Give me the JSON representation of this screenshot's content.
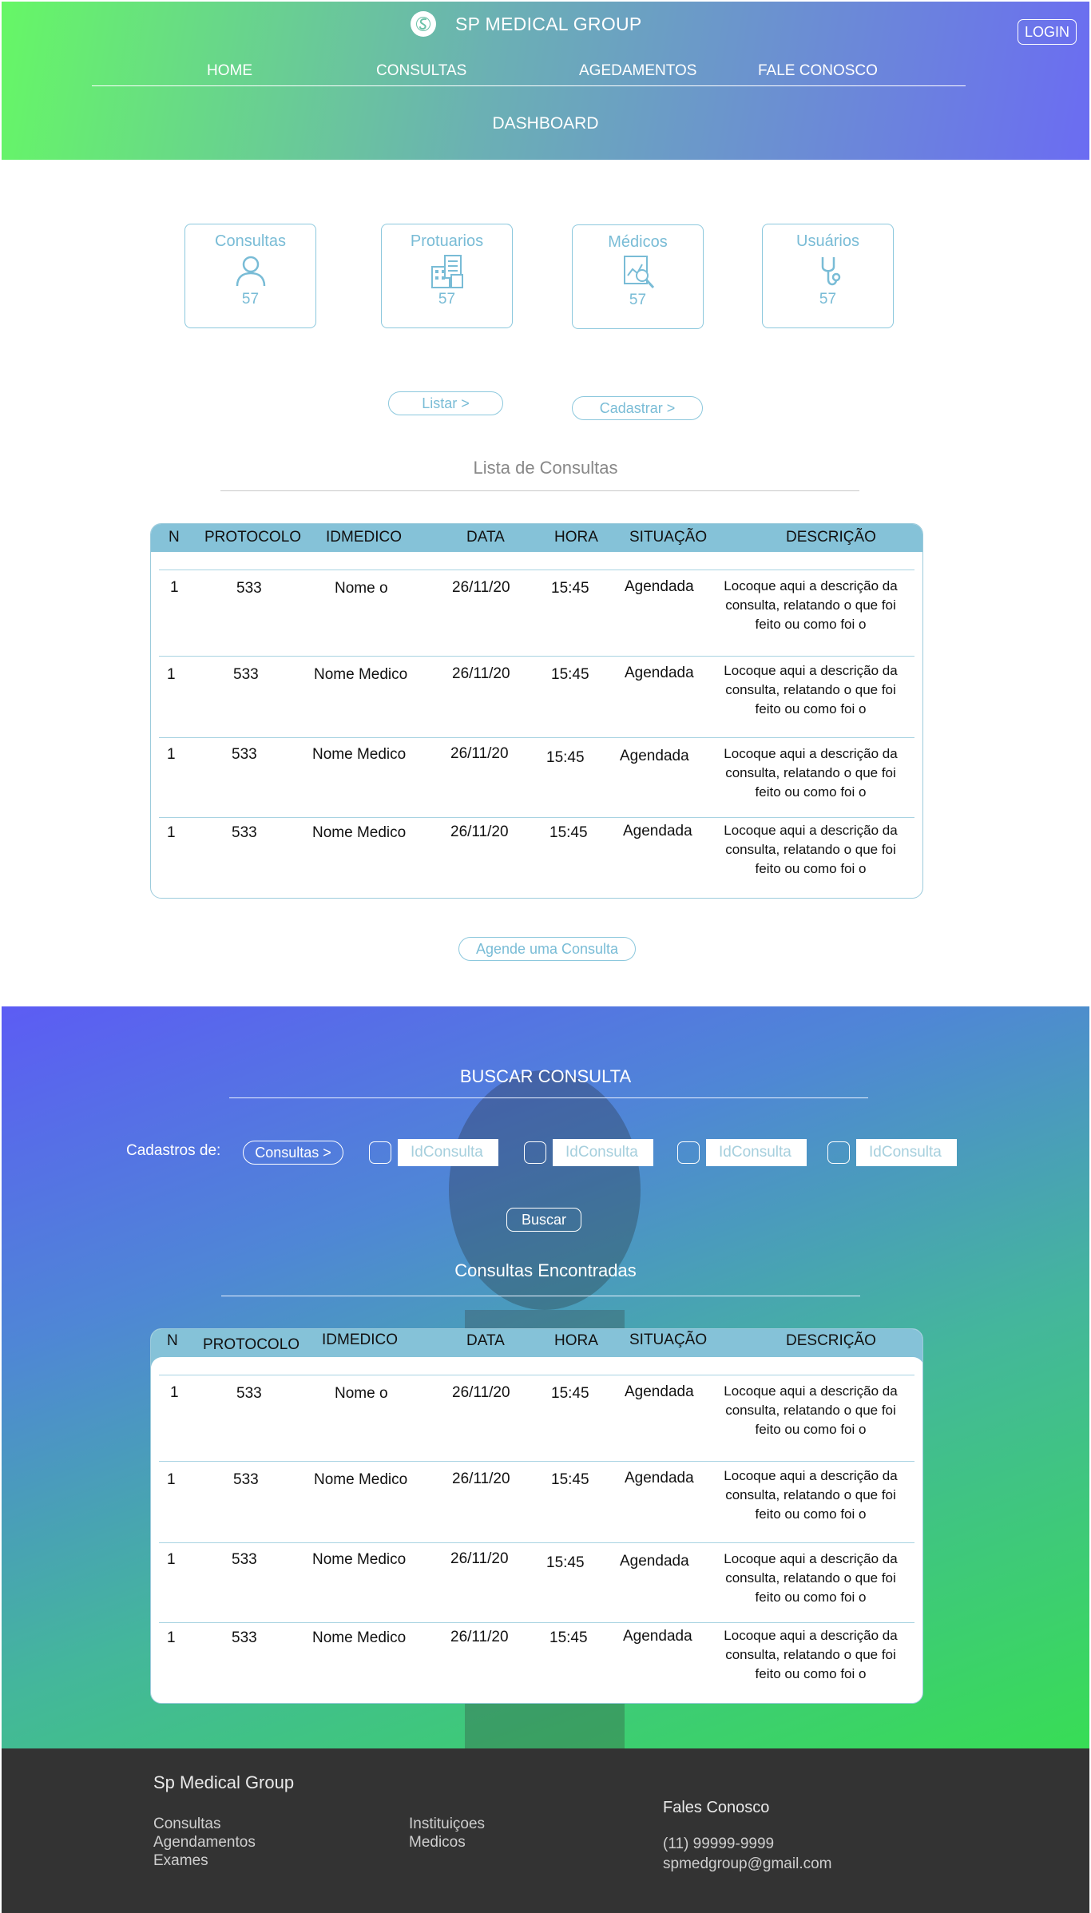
{
  "header": {
    "brand": "SP MEDICAL GROUP",
    "login_label": "LOGIN",
    "nav": [
      "HOME",
      "CONSULTAS",
      "AGEDAMENTOS",
      "FALE CONOSCO"
    ],
    "title": "DASHBOARD"
  },
  "stats": [
    {
      "label": "Consultas",
      "value": "57",
      "icon": "user-icon"
    },
    {
      "label": "Protuarios",
      "value": "57",
      "icon": "records-icon"
    },
    {
      "label": "Médicos",
      "value": "57",
      "icon": "chart-doc-icon"
    },
    {
      "label": "Usuários",
      "value": "57",
      "icon": "stethoscope-icon"
    }
  ],
  "actions": {
    "list_label": "Listar >",
    "register_label": "Cadastrar >"
  },
  "list_section": {
    "title": "Lista de Consultas"
  },
  "table": {
    "headers": [
      "N",
      "PROTOCOLO",
      "IDMEDICO",
      "DATA",
      "HORA",
      "SITUAÇÃO",
      "DESCRIÇÃO"
    ],
    "rows": [
      {
        "n": "1",
        "protocolo": "533",
        "medico": "Nome o",
        "data": "26/11/20",
        "hora": "15:45",
        "situacao": "Agendada",
        "descricao": "Locoque aqui a descrição da consulta, relatando o que foi feito ou como foi o"
      },
      {
        "n": "1",
        "protocolo": "533",
        "medico": "Nome Medico",
        "data": "26/11/20",
        "hora": "15:45",
        "situacao": "Agendada",
        "descricao": "Locoque aqui a descrição da consulta, relatando o que foi feito ou como foi o"
      },
      {
        "n": "1",
        "protocolo": "533",
        "medico": "Nome Medico",
        "data": "26/11/20",
        "hora": "15:45",
        "situacao": "Agendada",
        "descricao": "Locoque aqui a descrição da consulta, relatando o que foi feito ou como foi o"
      },
      {
        "n": "1",
        "protocolo": "533",
        "medico": "Nome Medico",
        "data": "26/11/20",
        "hora": "15:45",
        "situacao": "Agendada",
        "descricao": "Locoque aqui a descrição da consulta, relatando o que foi feito ou como foi o"
      }
    ]
  },
  "schedule_label": "Agende uma Consulta",
  "search": {
    "title": "BUSCAR CONSULTA",
    "cadastros_label": "Cadastros de:",
    "consultas_label": "Consultas >",
    "input_placeholders": [
      "IdConsulta",
      "IdConsulta",
      "IdConsulta",
      "IdConsulta"
    ],
    "buscar_label": "Buscar",
    "results_title": "Consultas Encontradas"
  },
  "footer": {
    "brand": "Sp Medical Group",
    "col1": [
      "Consultas",
      "Agendamentos",
      "Exames"
    ],
    "col2": [
      "Instituiçoes",
      "Medicos"
    ],
    "contact_title": "Fales Conosco",
    "phone": "(11) 99999-9999",
    "email": "spmedgroup@gmail.com"
  },
  "colors": {
    "accent": "#79bcd6",
    "header_start": "#66f766",
    "header_end": "#6b6cf2",
    "footer": "#333333"
  }
}
